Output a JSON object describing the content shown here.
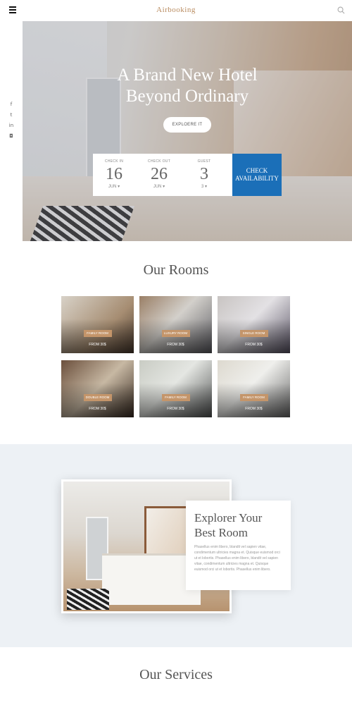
{
  "header": {
    "logo": "Airbooking",
    "menu_icon": "hamburger-menu-icon",
    "search_icon": "search-icon"
  },
  "social": [
    {
      "icon": "facebook-icon",
      "glyph": "f"
    },
    {
      "icon": "twitter-icon",
      "glyph": "t"
    },
    {
      "icon": "linkedin-icon",
      "glyph": "in"
    },
    {
      "icon": "instagram-icon",
      "glyph": "◘"
    }
  ],
  "hero": {
    "title_line1": "A Brand New Hotel",
    "title_line2": "Beyond Ordinary",
    "explore_label": "EXPLOERE IT"
  },
  "booking": {
    "check_in": {
      "label": "CHECK IN",
      "value": "16",
      "sub": "JUN ▾"
    },
    "check_out": {
      "label": "CHECK OUT",
      "value": "26",
      "sub": "JUN ▾"
    },
    "guest": {
      "label": "GUEST",
      "value": "3",
      "sub": "3 ▾"
    },
    "button_line1": "CHECK",
    "button_line2": "AVAILABILITY"
  },
  "rooms": {
    "title": "Our Rooms",
    "items": [
      {
        "badge": "FAMILY ROOM",
        "price": "FROM 30$"
      },
      {
        "badge": "LUXURY ROOM",
        "price": "FROM 30$"
      },
      {
        "badge": "SINGLE ROOM",
        "price": "FROM 30$"
      },
      {
        "badge": "DOUBLE ROOM",
        "price": "FROM 30$"
      },
      {
        "badge": "FAMILY ROOM",
        "price": "FROM 30$"
      },
      {
        "badge": "FAMILY ROOM",
        "price": "FROM 30$"
      }
    ]
  },
  "explorer": {
    "title_line1": "Explorer Your",
    "title_line2": "Best Room",
    "text": "Phasellus enim libero, blandit vel sapien vitae, condimentum ultricies magna et. Quisque euismod orci ut et lobortis. Phasellus enim libero, blandit vel sapien vitae, condimentum ultricies magna et. Quisque euismod orci ut et lobortis. Phasellus enim libero."
  },
  "services": {
    "title": "Our Services"
  },
  "colors": {
    "accent": "#c4956a",
    "logo": "#b98b5f",
    "button_blue": "#1b6fb8",
    "section_bg": "#edf1f5"
  }
}
